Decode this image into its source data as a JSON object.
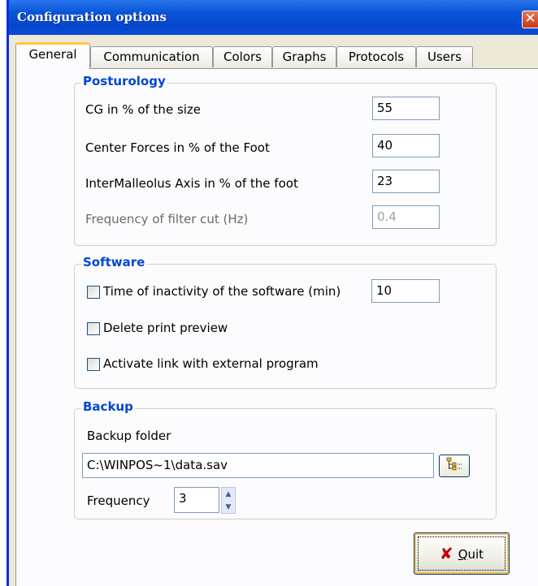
{
  "window": {
    "title": "Configuration options",
    "close_symbol": "✕"
  },
  "tabs": [
    {
      "label": "General",
      "active": true
    },
    {
      "label": "Communication",
      "active": false
    },
    {
      "label": "Colors",
      "active": false
    },
    {
      "label": "Graphs",
      "active": false
    },
    {
      "label": "Protocols",
      "active": false
    },
    {
      "label": "Users",
      "active": false
    }
  ],
  "posturology": {
    "title": "Posturology",
    "fields": [
      {
        "label": "CG in % of the size",
        "value": "55",
        "enabled": true
      },
      {
        "label": "Center Forces in % of the Foot",
        "value": "40",
        "enabled": true
      },
      {
        "label": "InterMalleolus Axis in  % of the foot",
        "value": "23",
        "enabled": true
      },
      {
        "label": "Frequency of filter cut (Hz)",
        "value": "0.4",
        "enabled": false
      }
    ]
  },
  "software": {
    "title": "Software",
    "inactivity_label": "Time of inactivity of the software (min)",
    "inactivity_checked": false,
    "inactivity_value": "10",
    "delete_preview_label": "Delete print preview",
    "delete_preview_checked": false,
    "external_link_label": "Activate link with external program",
    "external_link_checked": false
  },
  "backup": {
    "title": "Backup",
    "folder_label": "Backup folder",
    "folder_value": "C:\\WINPOS~1\\data.sav",
    "browse_icon": "folder-tree-icon",
    "frequency_label": "Frequency",
    "frequency_value": "3"
  },
  "quit_button": {
    "icon": "red-x-icon",
    "label_underlined": "Q",
    "label_rest": "uit"
  },
  "colors": {
    "titlebar": "#0a55d8",
    "group_title": "#0046d5",
    "tab_active_accent": "#ffc83c",
    "dialog_face": "#ece9d8"
  }
}
